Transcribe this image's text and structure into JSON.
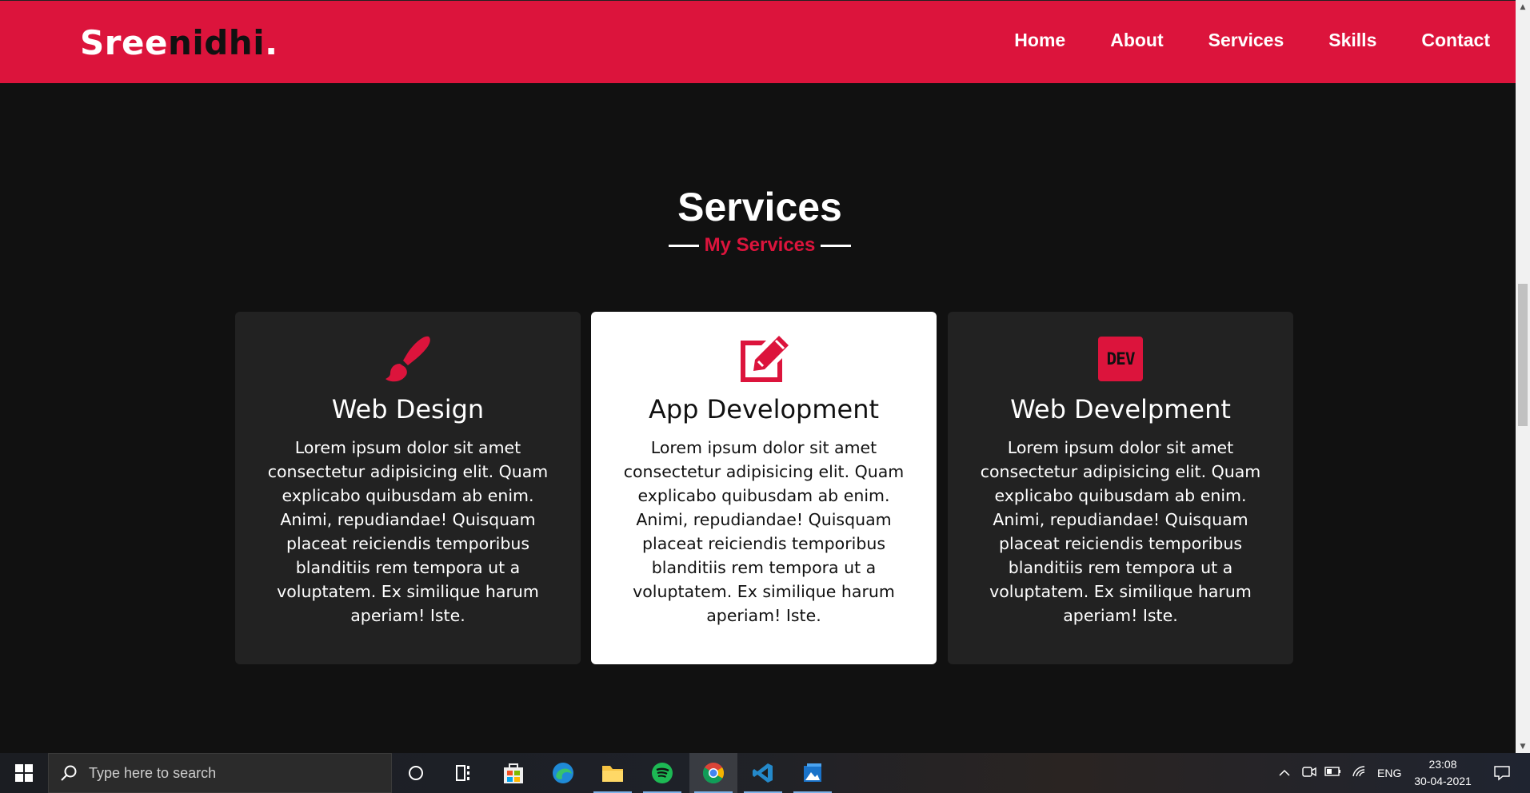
{
  "nav": {
    "logo_part1": "Sree",
    "logo_part2": "nidhi",
    "logo_dot": ".",
    "links": [
      "Home",
      "About",
      "Services",
      "Skills",
      "Contact"
    ]
  },
  "services": {
    "title": "Services",
    "subtitle": "My Services",
    "cards": [
      {
        "icon": "paint-brush-icon",
        "title": "Web Design",
        "text": "Lorem ipsum dolor sit amet consectetur adipisicing elit. Quam explicabo quibusdam ab enim. Animi, repudiandae! Quisquam placeat reiciendis temporibus blanditiis rem tempora ut a voluptatem. Ex similique harum aperiam! Iste."
      },
      {
        "icon": "edit-icon",
        "title": "App Development",
        "text": "Lorem ipsum dolor sit amet consectetur adipisicing elit. Quam explicabo quibusdam ab enim. Animi, repudiandae! Quisquam placeat reiciendis temporibus blanditiis rem tempora ut a voluptatem. Ex similique harum aperiam! Iste."
      },
      {
        "icon": "dev-icon",
        "icon_text": "DEV",
        "title": "Web Develpment",
        "text": "Lorem ipsum dolor sit amet consectetur adipisicing elit. Quam explicabo quibusdam ab enim. Animi, repudiandae! Quisquam placeat reiciendis temporibus blanditiis rem tempora ut a voluptatem. Ex similique harum aperiam! Iste."
      }
    ]
  },
  "colors": {
    "accent": "#dc143c",
    "background": "#111111",
    "card_dark": "#222222",
    "card_light": "#ffffff"
  },
  "taskbar": {
    "search_placeholder": "Type here to search",
    "language": "ENG",
    "time": "23:08",
    "date": "30-04-2021"
  }
}
